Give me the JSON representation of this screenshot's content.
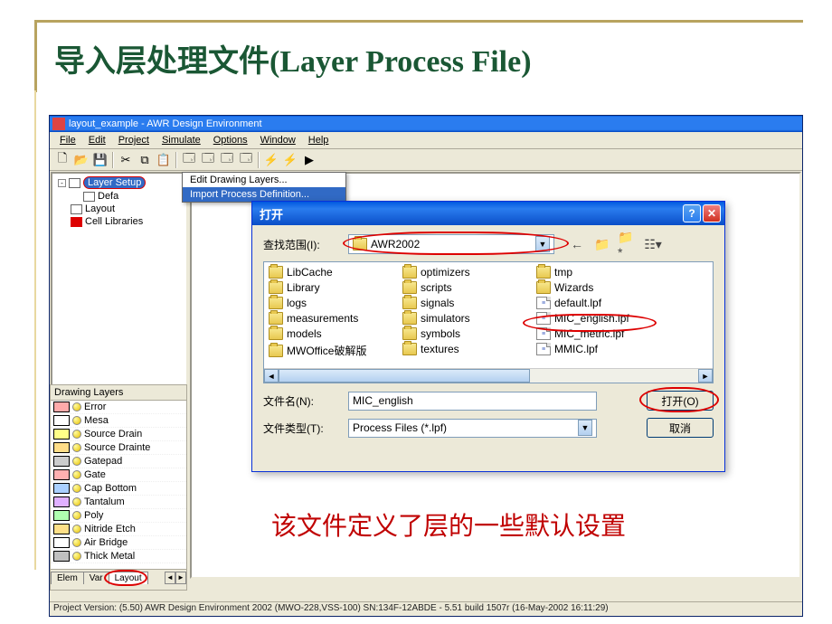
{
  "slide": {
    "title": "导入层处理文件(Layer Process File)",
    "caption": "该文件定义了层的一些默认设置"
  },
  "app": {
    "title": "layout_example - AWR Design Environment",
    "menus": [
      "File",
      "Edit",
      "Project",
      "Simulate",
      "Options",
      "Window",
      "Help"
    ],
    "status": "Project Version: (5.50) AWR Design Environment 2002 (MWO-228,VSS-100) SN:134F-12ABDE - 5.51 build 1507r (16-May-2002 16:11:29)"
  },
  "tree": {
    "items": [
      {
        "label": "Layer Setup",
        "selected": true
      },
      {
        "label": "Defa",
        "indent": 1
      },
      {
        "label": "Layout",
        "indent": 0
      },
      {
        "label": "Cell Libraries",
        "indent": 0
      }
    ]
  },
  "context_menu": {
    "items": [
      {
        "label": "Edit Drawing Layers...",
        "selected": false
      },
      {
        "label": "Import Process Definition...",
        "selected": true
      }
    ]
  },
  "dialog": {
    "title": "打开",
    "look_in_label": "查找范围(I):",
    "look_in_value": "AWR2002",
    "filename_label": "文件名(N):",
    "filename_value": "MIC_english",
    "filetype_label": "文件类型(T):",
    "filetype_value": "Process Files (*.lpf)",
    "open_btn": "打开(O)",
    "cancel_btn": "取消",
    "cols": [
      [
        "LibCache",
        "Library",
        "logs",
        "measurements",
        "models",
        "MWOffice破解版"
      ],
      [
        "optimizers",
        "scripts",
        "signals",
        "simulators",
        "symbols",
        "textures"
      ],
      [
        "tmp",
        "Wizards",
        "default.lpf",
        "MIC_english.lpf",
        "MIC_metric.lpf",
        "MMIC.lpf"
      ]
    ]
  },
  "layers": {
    "title": "Drawing Layers",
    "items": [
      {
        "name": "Error",
        "color": "#ffaaaa"
      },
      {
        "name": "Mesa",
        "color": "#ffffff"
      },
      {
        "name": "Source Drain",
        "color": "#ffff88"
      },
      {
        "name": "Source Drainte",
        "color": "#ffdd88"
      },
      {
        "name": "Gatepad",
        "color": "#cccccc"
      },
      {
        "name": "Gate",
        "color": "#ffb0b0"
      },
      {
        "name": "Cap Bottom",
        "color": "#aad0ff"
      },
      {
        "name": "Tantalum",
        "color": "#e0b0ff"
      },
      {
        "name": "Poly",
        "color": "#b0ffb0"
      },
      {
        "name": "Nitride Etch",
        "color": "#ffe088"
      },
      {
        "name": "Air Bridge",
        "color": "#ffffff"
      },
      {
        "name": "Thick Metal",
        "color": "#c0c0c0"
      }
    ],
    "tabs": [
      "Elem",
      "Var",
      "Layout"
    ]
  }
}
